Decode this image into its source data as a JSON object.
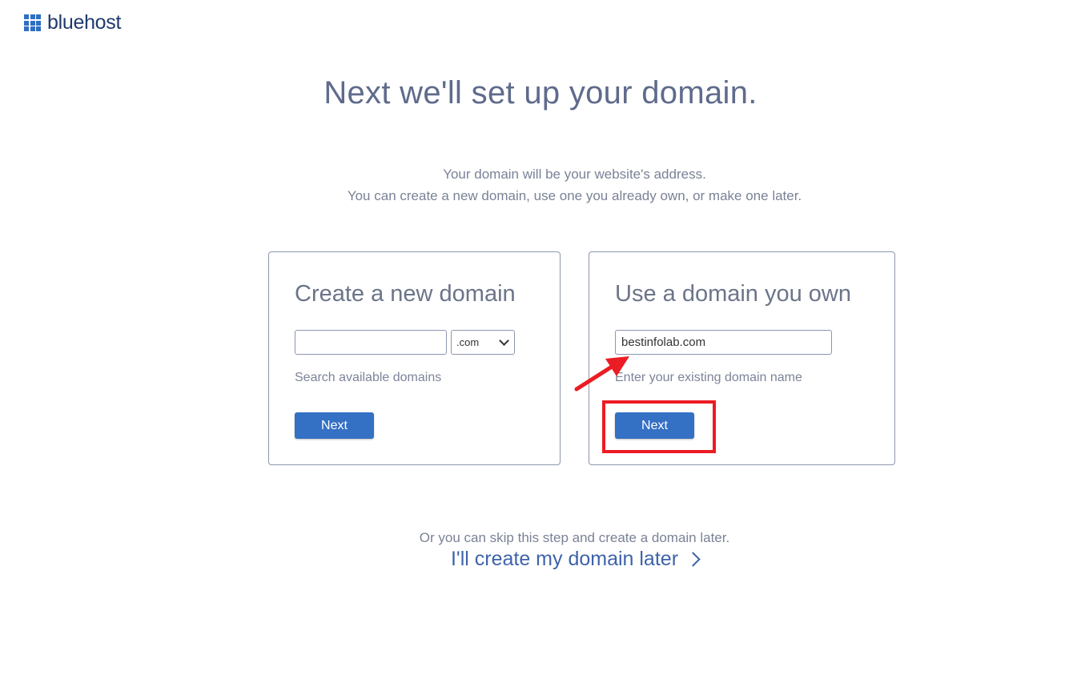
{
  "brand": {
    "name": "bluehost",
    "accent_color": "#3470c4",
    "highlight_color": "#ec1c24"
  },
  "header": {
    "title": "Next we'll set up your domain.",
    "subtitle_line1": "Your domain will be your website's address.",
    "subtitle_line2": "You can create a new domain, use one you already own, or make one later."
  },
  "create_card": {
    "title": "Create a new domain",
    "domain_value": "",
    "tld_selected": ".com",
    "helper_text": "Search available domains",
    "button_label": "Next"
  },
  "own_card": {
    "title": "Use a domain you own",
    "domain_value": "bestinfolab.com",
    "helper_text": "Enter your existing domain name",
    "button_label": "Next"
  },
  "footer": {
    "skip_text": "Or you can skip this step and create a domain later.",
    "skip_link": "I'll create my domain later"
  },
  "icons": {
    "logo": "grid-icon",
    "select_arrow": "chevron-down-icon",
    "link_arrow": "chevron-right-icon",
    "annotation_arrow": "red-arrow-icon"
  }
}
